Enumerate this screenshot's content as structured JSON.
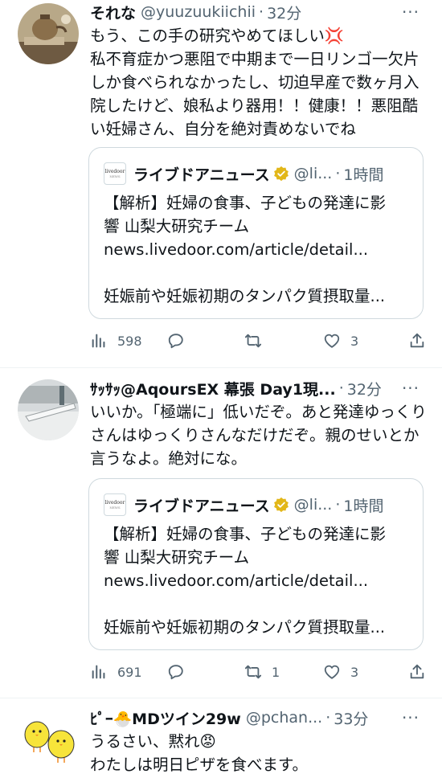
{
  "tweets": [
    {
      "name": "それな",
      "handle": "@yuuzuukiichii",
      "time": "32分",
      "body": "もう、この手の研究やめてほしい💢\n私不育症かつ悪阻で中期まで一日リンゴ一欠片しか食べられなかったし、切迫早産で数ヶ月入院したけど、娘私より器用！！健康！！悪阻酷い妊婦さん、自分を絶対責めないでね",
      "quote": {
        "logo_top": "livedoor",
        "logo_bottom": "NEWS",
        "name": "ライブドアニュース",
        "handle": "@li...",
        "time": "1時間",
        "line1": "【解析】妊婦の食事、子どもの発達に影",
        "line2": "響 山梨大研究チーム",
        "line3": "news.livedoor.com/article/detail...",
        "line4": "",
        "line5": "妊娠前や妊娠初期のタンパク質摂取量..."
      },
      "actions": {
        "views": "598",
        "replies": "",
        "retweets": "",
        "likes": "3"
      }
    },
    {
      "name": "ｻｯｻｯ@AqoursEX 幕張 Day1現...",
      "handle": "",
      "time": "32分",
      "body": "いいか。「極端に」低いだぞ。あと発達ゆっくりさんはゆっくりさんなだけだぞ。親のせいとか言うなよ。絶対にな。",
      "quote": {
        "logo_top": "livedoor",
        "logo_bottom": "NEWS",
        "name": "ライブドアニュース",
        "handle": "@li...",
        "time": "1時間",
        "line1": "【解析】妊婦の食事、子どもの発達に影",
        "line2": "響 山梨大研究チーム",
        "line3": "news.livedoor.com/article/detail...",
        "line4": "",
        "line5": "妊娠前や妊娠初期のタンパク質摂取量..."
      },
      "actions": {
        "views": "691",
        "replies": "",
        "retweets": "1",
        "likes": "3"
      }
    },
    {
      "name": "ﾋﾟｰ🐣MDツイン29w",
      "handle": "@pchan...",
      "time": "33分",
      "body": "うるさい、黙れ😡\nわたしは明日ピザを食べます。"
    }
  ],
  "icons": {
    "more": "more-dots-icon",
    "views": "bar-chart-icon",
    "reply": "speech-bubble-icon",
    "retweet": "retweet-arrows-icon",
    "like": "heart-icon",
    "share": "share-upload-icon",
    "verified": "gold-verified-badge-icon"
  },
  "colors": {
    "text": "#0f1419",
    "secondary": "#536471",
    "border": "#cfd9de",
    "divider": "#eff3f4",
    "verified_gold": "#e2b719"
  }
}
